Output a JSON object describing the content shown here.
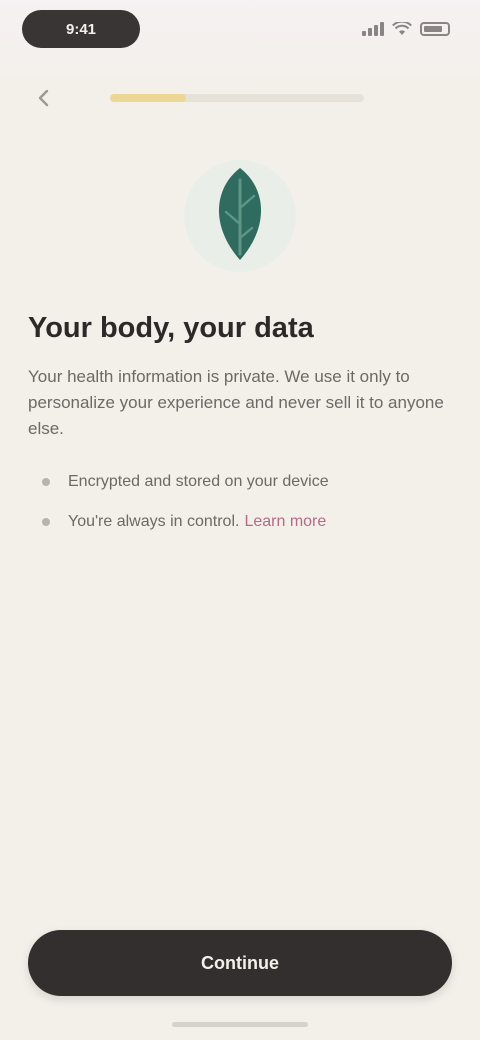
{
  "status_bar": {
    "time": "9:41"
  },
  "onboarding": {
    "progress_percent": 30,
    "title": "Your body, your data",
    "description": "Your health information is private. We use it only to personalize your experience and never sell it to anyone else.",
    "bullets": [
      {
        "text": "Encrypted and stored on your device"
      },
      {
        "text": "You're always in control.",
        "link_text": "Learn more"
      }
    ],
    "continue_label": "Continue"
  },
  "colors": {
    "background": "#f3f0ea",
    "progress_fill": "#ecd894",
    "hero_leaf": "#2f6b5e",
    "button": "#332f2e",
    "link": "#b46a88"
  },
  "icons": {
    "back": "chevron-left-icon",
    "hero": "leaf-icon",
    "signal": "signal-icon",
    "wifi": "wifi-icon",
    "battery": "battery-icon"
  }
}
